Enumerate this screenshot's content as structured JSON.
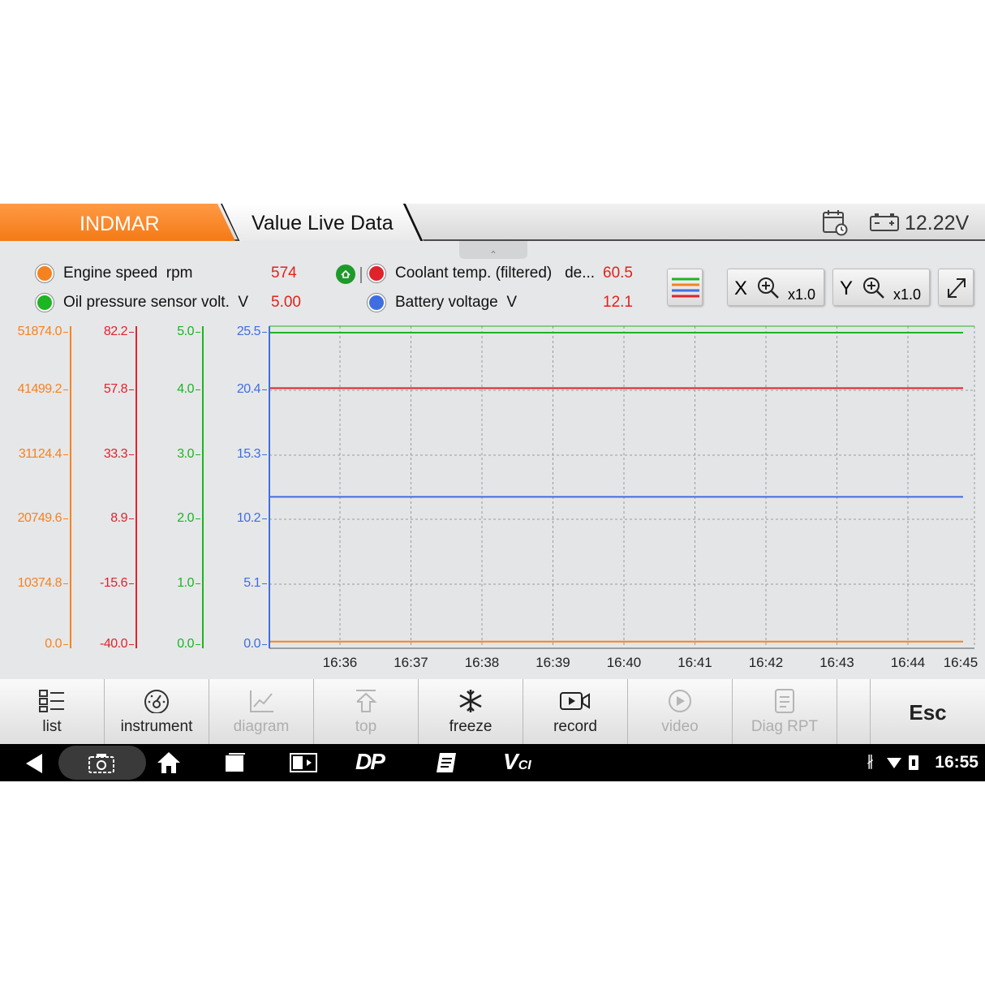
{
  "header": {
    "brand": "INDMAR",
    "title": "Value Live Data",
    "battery_voltage": "12.22V"
  },
  "legend": [
    {
      "name": "Engine speed",
      "unit": "rpm",
      "value": "574",
      "color": "#f58220"
    },
    {
      "name": "Oil pressure sensor volt.",
      "unit": "V",
      "value": "5.00",
      "color": "#1db521"
    },
    {
      "name": "Coolant temp. (filtered)",
      "unit": "de...",
      "value": "60.5",
      "color": "#e0232b"
    },
    {
      "name": "Battery voltage",
      "unit": "V",
      "value": "12.1",
      "color": "#3f6ee0"
    }
  ],
  "toolbar": {
    "x_label": "X",
    "x_zoom": "x1.0",
    "y_label": "Y",
    "y_zoom": "x1.0"
  },
  "chart_data": {
    "type": "line",
    "x": [
      "16:36",
      "16:37",
      "16:38",
      "16:39",
      "16:40",
      "16:41",
      "16:42",
      "16:43",
      "16:44",
      "16:45"
    ],
    "y_axes": [
      {
        "name": "Engine speed",
        "color": "#f58220",
        "ticks": [
          "51874.0",
          "41499.2",
          "31124.4",
          "20749.6",
          "10374.8",
          "0.0"
        ],
        "ylim": [
          0,
          51874
        ]
      },
      {
        "name": "Coolant temp. (filtered)",
        "color": "#e0232b",
        "ticks": [
          "82.2",
          "57.8",
          "33.3",
          "8.9",
          "-15.6",
          "-40.0"
        ],
        "ylim": [
          -40,
          82.2
        ]
      },
      {
        "name": "Oil pressure sensor volt.",
        "color": "#1db521",
        "ticks": [
          "5.0",
          "4.0",
          "3.0",
          "2.0",
          "1.0",
          "0.0"
        ],
        "ylim": [
          0,
          5
        ]
      },
      {
        "name": "Battery voltage",
        "color": "#3f6ee0",
        "ticks": [
          "25.5",
          "20.4",
          "15.3",
          "10.2",
          "5.1",
          "0.0"
        ],
        "ylim": [
          0,
          25.5
        ]
      }
    ],
    "series": [
      {
        "name": "Engine speed",
        "color": "#f58220",
        "axis": 0,
        "values": [
          574,
          574,
          574,
          574,
          574,
          574,
          574,
          574,
          574,
          574
        ]
      },
      {
        "name": "Coolant temp. (filtered)",
        "color": "#e0232b",
        "axis": 1,
        "values": [
          60.5,
          60.5,
          60.5,
          60.5,
          60.5,
          60.5,
          60.5,
          60.5,
          60.5,
          60.5
        ]
      },
      {
        "name": "Oil pressure sensor volt.",
        "color": "#1db521",
        "axis": 2,
        "values": [
          5.0,
          5.0,
          5.0,
          5.0,
          5.0,
          5.0,
          5.0,
          5.0,
          5.0,
          5.0
        ]
      },
      {
        "name": "Battery voltage",
        "color": "#3f6ee0",
        "axis": 3,
        "values": [
          12.1,
          12.1,
          12.1,
          12.1,
          12.1,
          12.1,
          12.1,
          12.1,
          12.1,
          12.1
        ]
      }
    ],
    "grid": true
  },
  "bottom_buttons": [
    {
      "label": "list",
      "icon": "list-icon",
      "enabled": true
    },
    {
      "label": "instrument",
      "icon": "gauge-icon",
      "enabled": true
    },
    {
      "label": "diagram",
      "icon": "diagram-icon",
      "enabled": false
    },
    {
      "label": "top",
      "icon": "arrow-top-icon",
      "enabled": false
    },
    {
      "label": "freeze",
      "icon": "snowflake-icon",
      "enabled": true
    },
    {
      "label": "record",
      "icon": "camera-record-icon",
      "enabled": true
    },
    {
      "label": "video",
      "icon": "play-circle-icon",
      "enabled": false
    },
    {
      "label": "Diag RPT",
      "icon": "report-icon",
      "enabled": false
    }
  ],
  "esc_label": "Esc",
  "statusbar": {
    "time": "16:55"
  }
}
